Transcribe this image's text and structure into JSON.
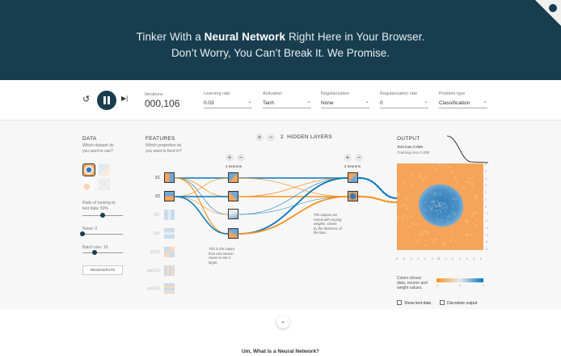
{
  "banner": {
    "line1_pre": "Tinker With a ",
    "line1_bold": "Neural Network",
    "line1_post": " Right Here in Your Browser.",
    "line2": "Don’t Worry, You Can’t Break It. We Promise."
  },
  "controls": {
    "reset_icon": "reset-icon",
    "play_icon": "pause-icon",
    "step_icon": "step-icon",
    "iterations_label": "Iterations",
    "iterations_value": "000,106",
    "learning_rate": {
      "label": "Learning rate",
      "value": "0.03"
    },
    "activation": {
      "label": "Activation",
      "value": "Tanh"
    },
    "regularization": {
      "label": "Regularization",
      "value": "None"
    },
    "regularization_rate": {
      "label": "Regularization rate",
      "value": "0"
    },
    "problem_type": {
      "label": "Problem type",
      "value": "Classification"
    }
  },
  "data_panel": {
    "title": "DATA",
    "question_1": "Which dataset do",
    "question_2": "you want to use?",
    "ratio_1": "Ratio of training to",
    "ratio_2": "test data: 50%",
    "ratio_fraction": 0.5,
    "noise_label": "Noise: 0",
    "noise_fraction": 0.0,
    "batch_label": "Batch size: 10",
    "batch_fraction": 0.3,
    "regenerate": "REGENERATE"
  },
  "features_panel": {
    "title": "FEATURES",
    "question_1": "Which properties do",
    "question_2": "you want to feed in?",
    "features": [
      "X1",
      "X2",
      "X1²",
      "X2²",
      "X1X2",
      "sin(X1)",
      "sin(X2)"
    ]
  },
  "hidden": {
    "count": "2",
    "label": "HIDDEN LAYERS",
    "layer1_neurons": "4 neurons",
    "layer2_neurons": "2 neurons",
    "note1_1": "This is the output",
    "note1_2": "from one neuron.",
    "note1_3": "Hover to see it",
    "note1_4": "larger.",
    "note2_1": "The outputs are",
    "note2_2": "mixed with varying",
    "note2_3": "weights, shown",
    "note2_4": "by the thickness of",
    "note2_5": "the lines."
  },
  "output_panel": {
    "title": "OUTPUT",
    "test_loss": "Test loss 0.006",
    "training_loss": "Training loss 0.005",
    "y_ticks": [
      "6",
      "5",
      "4",
      "3",
      "2",
      "1",
      "0",
      "-1",
      "-2",
      "-3",
      "-4",
      "-5",
      "-6"
    ],
    "x_ticks": [
      "-6",
      "-5",
      "-4",
      "-3",
      "-2",
      "-1",
      "0",
      "1",
      "2",
      "3",
      "4",
      "5",
      "6"
    ],
    "legend_1": "Colors shows",
    "legend_2": "data, neuron and",
    "legend_3": "weight values.",
    "legend_min": "-1",
    "legend_mid": "0",
    "legend_max": "1",
    "show_test": "Show test data",
    "discretize": "Discretize output"
  },
  "colors": {
    "navy": "#183d4e",
    "orange": "#f59322",
    "blue": "#0877bd"
  },
  "more_icon": "chevron-down-icon",
  "bottom_title": "Um, What Is a Neural Network?"
}
